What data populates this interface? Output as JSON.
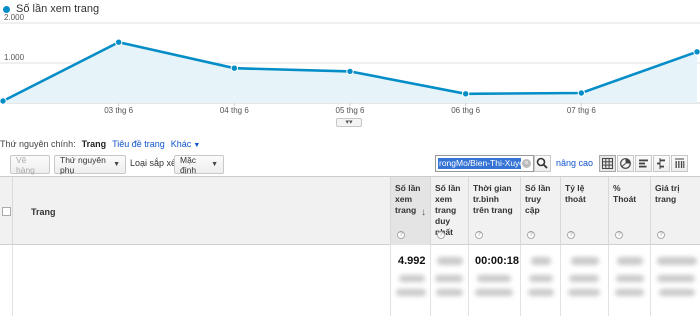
{
  "colors": {
    "accent": "#058dc7",
    "area": "#e6f4fa",
    "link": "#1155cc"
  },
  "chart_data": {
    "type": "area",
    "series": [
      {
        "name": "Số lần xem trang",
        "color": "#058dc7",
        "x": [
          "02 thg 6",
          "03 thg 6",
          "04 thg 6",
          "05 thg 6",
          "06 thg 6",
          "07 thg 6",
          "08 thg 6"
        ],
        "values": [
          50,
          1520,
          870,
          790,
          230,
          250,
          1280
        ]
      }
    ],
    "y_ticks": [
      1000,
      2000
    ],
    "y_tick_labels": [
      "1.000",
      "2.000"
    ],
    "ylim": [
      0,
      2000
    ],
    "x_tick_labels": [
      "03 thg 6",
      "04 thg 6",
      "05 thg 6",
      "06 thg 6",
      "07 thg 6"
    ],
    "grid": true,
    "legend_position": "top-left"
  },
  "dimension_bar": {
    "label": "Thứ nguyên chính:",
    "active": "Trang",
    "link": "Tiêu đề trang",
    "more": "Khác"
  },
  "toolbar": {
    "plot_rows": "Vẽ hàng",
    "secondary_dimension": "Thứ nguyên phụ",
    "sort_type_label": "Loại sắp xếp:",
    "sort_type_value": "Mặc định",
    "search_value": "rongMo/Bien-Thi-Xuyen",
    "advanced": "nâng cao",
    "search_icon": "search-icon",
    "view_icons": [
      "table-view-icon",
      "pie-view-icon",
      "bar-view-icon",
      "comparison-view-icon",
      "pivot-view-icon"
    ]
  },
  "table": {
    "columns": [
      {
        "header": "Trang"
      },
      {
        "header": "Số lần xem trang",
        "sorted": true,
        "help": "?"
      },
      {
        "header": "Số lần xem trang duy nhất",
        "help": "?"
      },
      {
        "header": "Thời gian tr.bình trên trang",
        "help": "?"
      },
      {
        "header": "Số lần truy cập",
        "help": "?"
      },
      {
        "header": "Tỷ lệ thoát",
        "help": "?"
      },
      {
        "header": "% Thoát",
        "help": "?"
      },
      {
        "header": "Giá trị trang",
        "help": "?"
      }
    ],
    "row": {
      "pageviews": "4.992",
      "avg_time": "00:00:18"
    }
  }
}
